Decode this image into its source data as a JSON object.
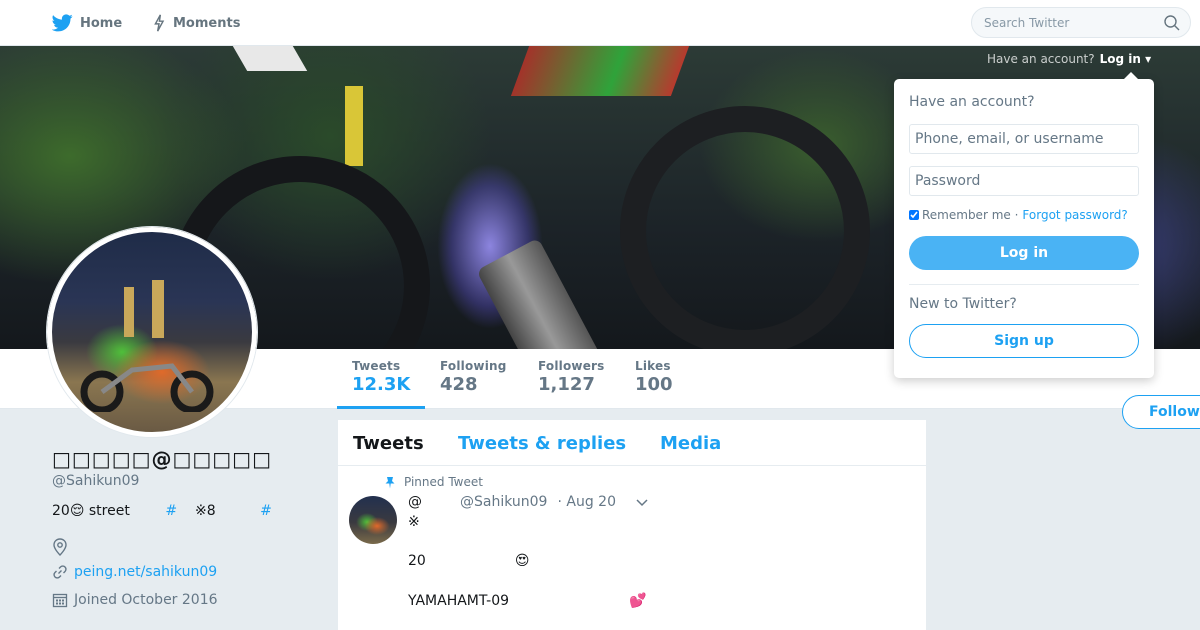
{
  "topnav": {
    "home_label": "Home",
    "moments_label": "Moments",
    "search_placeholder": "Search Twitter",
    "icons": {
      "home": "twitter-bird-icon",
      "moments": "lightning-icon",
      "search": "search-icon"
    }
  },
  "banner": {
    "login_hint": "Have an account?",
    "login_link": "Log in ▾"
  },
  "profile_nav": {
    "stats": [
      {
        "label": "Tweets",
        "value": "12.3K"
      },
      {
        "label": "Following",
        "value": "428"
      },
      {
        "label": "Followers",
        "value": "1,127"
      },
      {
        "label": "Likes",
        "value": "100"
      }
    ],
    "follow_label": "Follow"
  },
  "profile": {
    "name": "□□□□□@□□□□□",
    "handle": "@Sahikun09",
    "bio_start": "20😌 street",
    "bio_tag1": "#",
    "bio_mid": "※8",
    "bio_tag2": "#",
    "link": "peing.net/sahikun09",
    "joined": "Joined October 2016"
  },
  "timeline": {
    "tabs": [
      "Tweets",
      "Tweets & replies",
      "Media"
    ],
    "pinned_label": "Pinned Tweet",
    "tweet": {
      "at": "@",
      "handle": "@Sahikun09",
      "date": "· Aug 20",
      "line1": "※",
      "line2_text": "20",
      "line2_emoji": "😍",
      "line3_text": "YAMAHAMT-09",
      "line3_emoji": "💕"
    }
  },
  "login_dropdown": {
    "title": "Have an account?",
    "username_placeholder": "Phone, email, or username",
    "password_placeholder": "Password",
    "remember_label": "Remember me",
    "separator": "·",
    "forgot_label": "Forgot password?",
    "login_button": "Log in",
    "new_label": "New to Twitter?",
    "signup_button": "Sign up"
  },
  "colors": {
    "accent": "#1da1f2",
    "login_button_bg": "#4ab3f4",
    "background": "#e6ecf0"
  }
}
